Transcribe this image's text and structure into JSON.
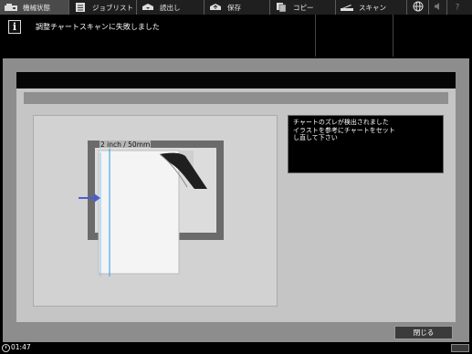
{
  "tabs": [
    {
      "label": "機械状態",
      "icon": "machine-status-icon",
      "active": true
    },
    {
      "label": "ジョブリスト",
      "icon": "job-list-icon",
      "active": false
    },
    {
      "label": "読出し",
      "icon": "recall-icon",
      "active": false
    },
    {
      "label": "保存",
      "icon": "store-icon",
      "active": false
    },
    {
      "label": "コピー",
      "icon": "copy-icon",
      "active": false
    },
    {
      "label": "スキャン",
      "icon": "scan-icon",
      "active": false
    }
  ],
  "message": {
    "icon": "info-icon",
    "icon_text": "i",
    "text": "調整チャートスキャンに失敗しました"
  },
  "illustration": {
    "measure_label": "2 inch / 50mm"
  },
  "info_box": {
    "lines": [
      "チャートのズレが検出されました",
      "イラストを参考にチャートをセット",
      "し直して下さい"
    ]
  },
  "buttons": {
    "close": "閉じる"
  },
  "status": {
    "time": "01:47"
  },
  "colors": {
    "accent_arrow": "#4a5fcf",
    "guide_line": "#4aa8e8"
  }
}
